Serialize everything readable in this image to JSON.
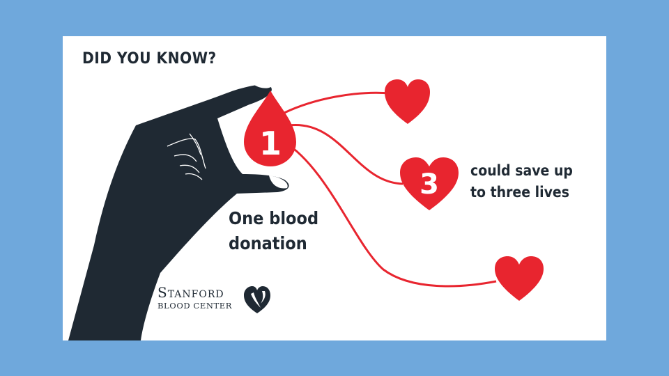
{
  "colors": {
    "background": "#6fa8dc",
    "card": "#ffffff",
    "hand": "#1f2933",
    "blood": "#e8252f",
    "text": "#1f2933"
  },
  "heading": "DID YOU KNOW?",
  "drop_number": "1",
  "heart_number": "3",
  "donation_text": {
    "line1": "One blood",
    "line2": "donation"
  },
  "lives_text": {
    "line1": "could save up",
    "line2": "to three lives"
  },
  "logo": {
    "name": "Stanford",
    "subtitle": "BLOOD CENTER",
    "icon": "heart-logo-icon"
  },
  "icons": [
    "hand-illustration",
    "blood-drop-icon",
    "heart-icon"
  ]
}
